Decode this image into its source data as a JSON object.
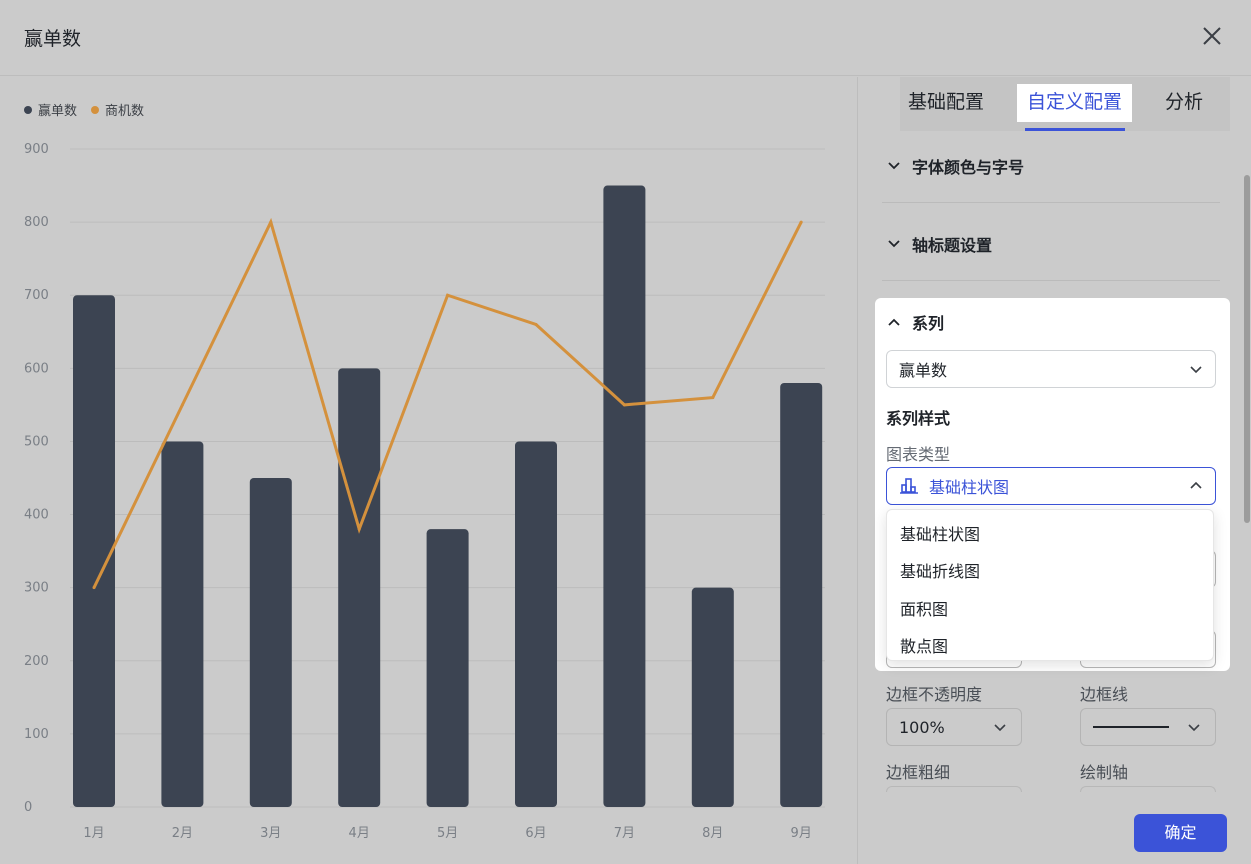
{
  "header": {
    "title": "赢单数"
  },
  "legend": [
    {
      "name": "赢单数",
      "color": "#3c4452"
    },
    {
      "name": "商机数",
      "color": "#d4913d"
    }
  ],
  "chart_data": {
    "type": "bar",
    "categories": [
      "1月",
      "2月",
      "3月",
      "4月",
      "5月",
      "6月",
      "7月",
      "8月",
      "9月"
    ],
    "series": [
      {
        "name": "赢单数",
        "type": "bar",
        "color": "#3c4452",
        "values": [
          700,
          500,
          450,
          600,
          380,
          500,
          850,
          300,
          580
        ]
      },
      {
        "name": "商机数",
        "type": "line",
        "color": "#d4913d",
        "values": [
          300,
          550,
          800,
          380,
          700,
          660,
          550,
          560,
          800
        ]
      }
    ],
    "yticks": [
      "0",
      "100",
      "200",
      "300",
      "400",
      "500",
      "600",
      "700",
      "800",
      "900"
    ],
    "ylim": [
      0,
      900
    ],
    "grid": true,
    "legend_position": "top-left"
  },
  "tabs": [
    {
      "label": "基础配置",
      "active": false
    },
    {
      "label": "自定义配置",
      "active": true
    },
    {
      "label": "分析",
      "active": false
    }
  ],
  "sections": {
    "font": "字体颜色与字号",
    "axis_title": "轴标题设置",
    "series": "系列"
  },
  "series_panel": {
    "selected_series": "赢单数",
    "style_heading": "系列样式",
    "chart_type_label": "图表类型",
    "chart_type_value": "基础柱状图",
    "options": [
      "基础柱状图",
      "基础折线图",
      "面积图",
      "散点图"
    ]
  },
  "bottom": {
    "border_opacity_label": "边框不透明度",
    "border_opacity_value": "100%",
    "border_line_label": "边框线",
    "border_width_label": "边框粗细",
    "draw_axis_label": "绘制轴"
  },
  "confirm_label": "确定",
  "colors": {
    "accent": "#3b53d8",
    "bar": "#3c4452",
    "line": "#d4913d"
  },
  "icons": {
    "close": "close-icon",
    "chart_type": "bar-chart-icon"
  }
}
